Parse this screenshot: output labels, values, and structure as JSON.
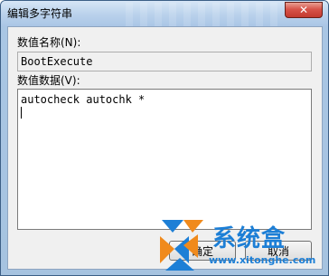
{
  "window": {
    "title": "编辑多字符串",
    "close_label": "✕"
  },
  "name_field": {
    "label": "数值名称(N):",
    "value": "BootExecute"
  },
  "data_field": {
    "label": "数值数据(V):",
    "value": "autocheck autochk *"
  },
  "buttons": {
    "ok_label": "确定",
    "cancel_label": "取消"
  },
  "watermark": {
    "brand": "系统盒",
    "url": "www.xitonghe.com",
    "colors": {
      "blue": "#1d7fd6",
      "orange": "#f08a1c"
    }
  }
}
